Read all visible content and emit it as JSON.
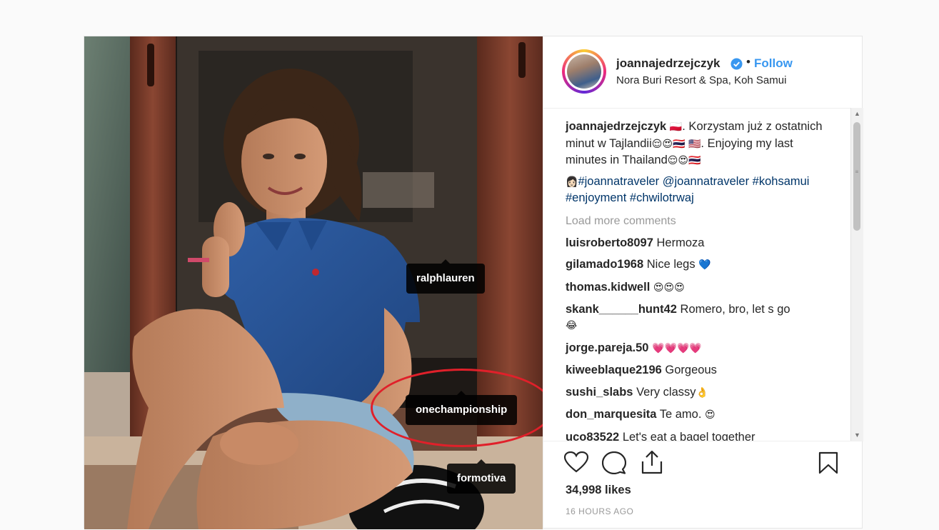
{
  "post": {
    "username": "joannajedrzejczyk",
    "follow_label": "Follow",
    "dot": "•",
    "location": "Nora Buri Resort & Spa, Koh Samui",
    "caption": {
      "username": "joannajedrzejczyk",
      "flag1": "🇵🇱",
      "line1": ". Korzystam już z ostatnich minut w Tajlandii",
      "emoji1": "😌😍🇹🇭",
      "flag2": "🇺🇸",
      "line2": ". Enjoying my last minutes in Thailand",
      "emoji2": "😌😍🇹🇭",
      "hash_emoji": "👩🏻",
      "hashtags": "#joannatraveler @joannatraveler #kohsamui #enjoyment #chwilotrwaj"
    },
    "load_more": "Load more comments",
    "comments": [
      {
        "user": "luisroberto8097",
        "text": "Hermoza",
        "emoji": ""
      },
      {
        "user": "gilamado1968",
        "text": "Nice legs",
        "emoji": "💙"
      },
      {
        "user": "thomas.kidwell",
        "text": "",
        "emoji": "😍😍😍"
      },
      {
        "user": "skank______hunt42",
        "text": "Romero, bro, let s go",
        "emoji": "😂"
      },
      {
        "user": "jorge.pareja.50",
        "text": "",
        "emoji": "💗💗💗💗"
      },
      {
        "user": "kiweeblaque2196",
        "text": "Gorgeous",
        "emoji": ""
      },
      {
        "user": "sushi_slabs",
        "text": "Very classy",
        "emoji": "👌"
      },
      {
        "user": "don_marquesita",
        "text": "Te amo.",
        "emoji": "😍"
      },
      {
        "user": "uco83522",
        "text": "Let's eat a bagel together",
        "emoji": ""
      }
    ],
    "likes": "34,998 likes",
    "time": "16 HOURS AGO"
  },
  "tags": {
    "ralph": "ralphlauren",
    "one": "onechampionship",
    "formo": "formotiva"
  },
  "scrollbar": {
    "up": "▲",
    "down": "▼",
    "grip": "≡"
  },
  "colors": {
    "follow": "#3897f0",
    "highlight_circle": "#e0202a",
    "hashtag": "#003569"
  },
  "icons": [
    "heart-icon",
    "comment-icon",
    "share-icon",
    "bookmark-icon",
    "verified-badge-icon"
  ]
}
